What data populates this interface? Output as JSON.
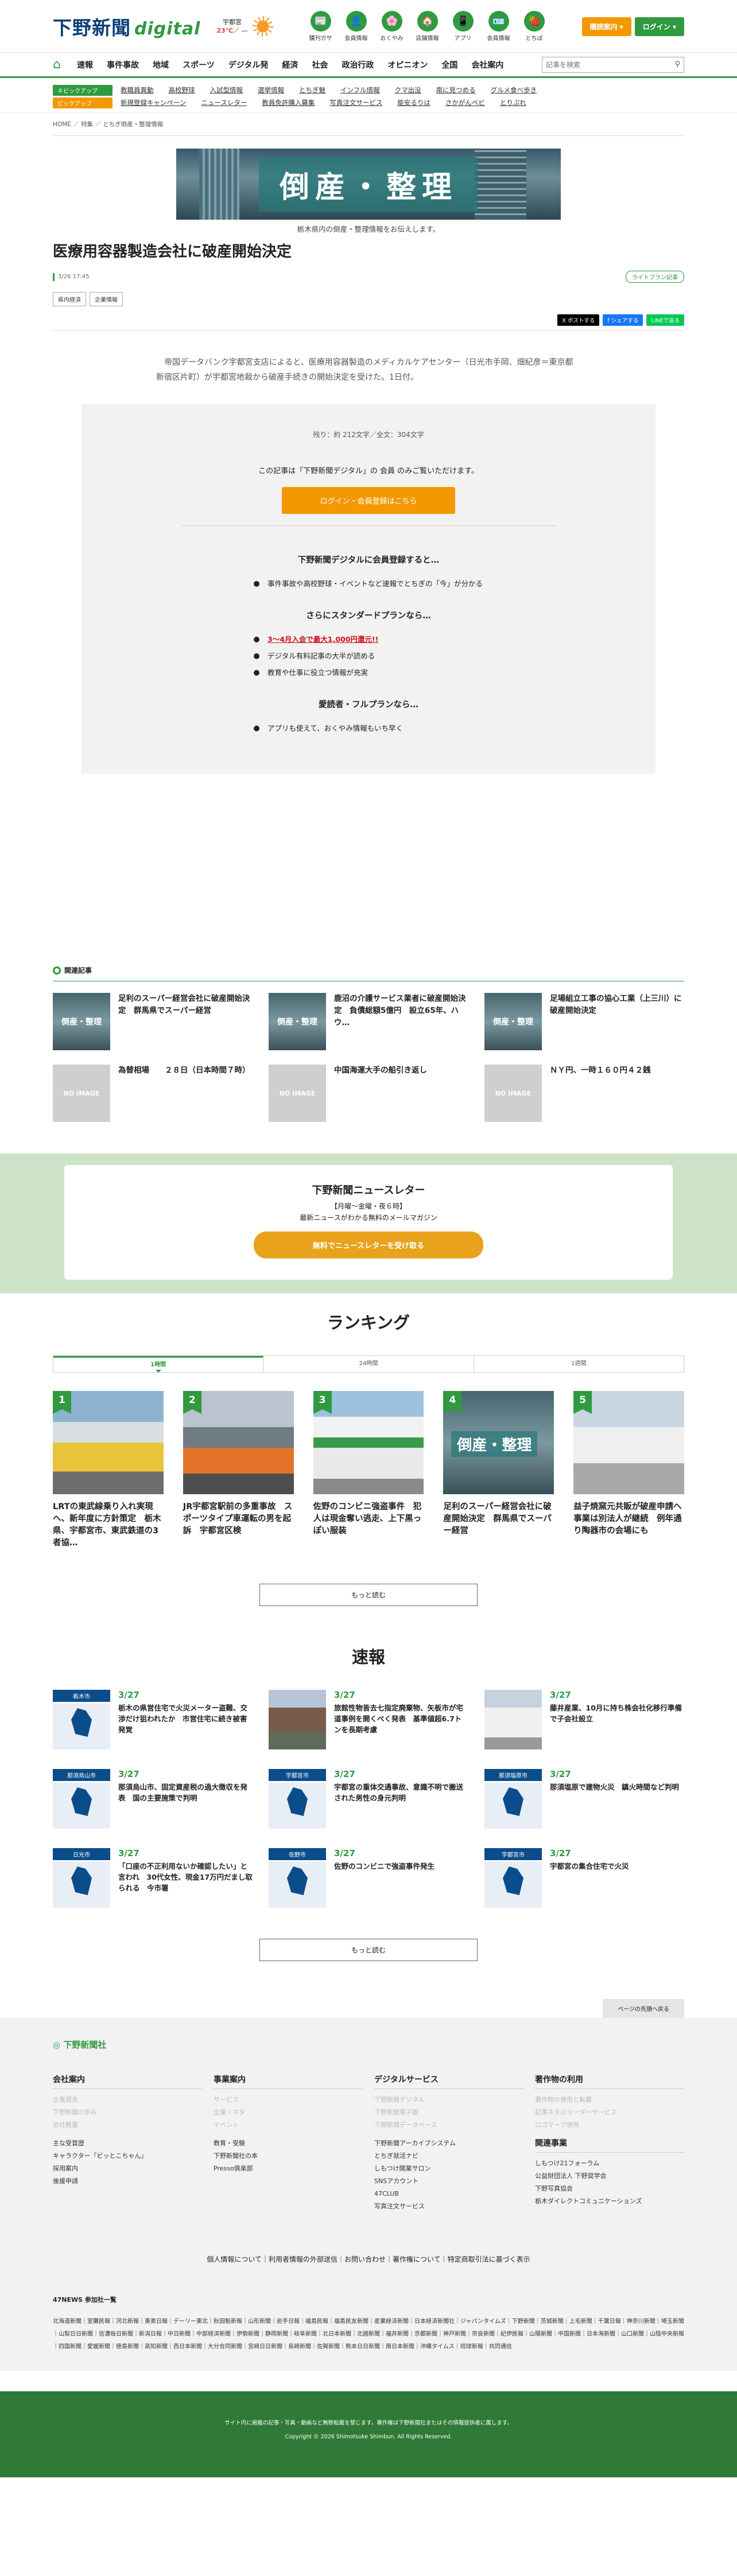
{
  "header": {
    "logo": "下野新聞",
    "logo_digital": "digital",
    "logo_digital_sub": "デジタル",
    "weather_city": "宇都宮",
    "weather_hi": "23℃",
    "weather_lo": "／ —",
    "icons": [
      {
        "label": "購刊ガサ",
        "glyph": "📰"
      },
      {
        "label": "会員情報",
        "glyph": "👤"
      },
      {
        "label": "おくやみ",
        "glyph": "🌸"
      },
      {
        "label": "店舗情報",
        "glyph": "🏠"
      },
      {
        "label": "アプリ",
        "glyph": "📱"
      },
      {
        "label": "会員情報",
        "glyph": "🪪"
      },
      {
        "label": "とちぽ",
        "glyph": "🍓"
      }
    ],
    "subscribe": "購読案内 ▾",
    "login": "ログイン ▾"
  },
  "nav": {
    "items": [
      "速報",
      "事件事故",
      "地域",
      "スポーツ",
      "デジタル発",
      "経済",
      "社会",
      "政治行政",
      "オピニオン",
      "全国",
      "会社案内"
    ],
    "search_placeholder": "記事を検索"
  },
  "subnav": {
    "row1_tag": "＃ピックアップ",
    "row1": [
      "教職員異動",
      "高校野球",
      "入試型情報",
      "選挙情報",
      "とちぎ魅",
      "インフル情報",
      "クマ出没",
      "南に見つめる",
      "グルメ食べ歩き"
    ],
    "row2_tag": "ピックアップ",
    "row2": [
      "新規登録キャンペーン",
      "ニュースレター",
      "教員免許購入募集",
      "写真注文サービス",
      "能安るりは",
      "さかがんベビ",
      "とりぷれ"
    ]
  },
  "breadcrumb": "HOME ／ 特集 ／ とちぎ倒産・整理情報",
  "article": {
    "banner_text": "倒産・整理",
    "banner_sub": "栃木県内の倒産・整理情報をお伝えします。",
    "title": "医療用容器製造会社に破産開始決定",
    "date": "3/26 17:45",
    "plan_badge": "ライトプラン記事",
    "tags": [
      "県内経済",
      "企業情報"
    ],
    "share": [
      "X ポストする",
      "f シェアする",
      "LINEで送る"
    ],
    "lead": "　帝国データバンク宇都宮支店によると、医療用容器製造のメディカルケアセンター（日光市手岡、畑紀彦＝東京都新宿区片町）が宇都宮地裁から破産手続きの開始決定を受けた。1日付。"
  },
  "paywall": {
    "remaining": "残り：約 212文字／全文：304文字",
    "only": "この記事は「下野新聞デジタル」の 会員 のみご覧いただけます。",
    "login_button": "ログイン・会員登録はこちら",
    "h_member": "下野新聞デジタルに会員登録すると…",
    "member_items": [
      "事件事故や高校野球・イベントなど速報でとちぎの「今」が分かる"
    ],
    "h_standard": "さらにスタンダードプランなら…",
    "standard_items": [
      "3～4月入会で最大1,000円還元!!",
      "デジタル有料記事の大半が読める",
      "教育や仕事に役立つ情報が充実"
    ],
    "h_full": "愛読者・フルプランなら…",
    "full_items": [
      "アプリも使えて、おくやみ情報もいち早く"
    ]
  },
  "related": {
    "heading": "関連記事",
    "items": [
      {
        "title": "足利のスーパー経営会社に破産開始決定　群馬県でスーパー経営",
        "thumb": "倒産・整理"
      },
      {
        "title": "鹿沼の介護サービス業者に破産開始決定　負債総額5億円　設立65年、ハウ…",
        "thumb": "倒産・整理"
      },
      {
        "title": "足場組立工事の協心工業（上三川）に破産開始決定",
        "thumb": "倒産・整理"
      },
      {
        "title": "為替相場　　２８日（日本時間７時）",
        "thumb": "NO IMAGE"
      },
      {
        "title": "中国海運大手の船引き返し",
        "thumb": "NO IMAGE"
      },
      {
        "title": "ＮＹ円、一時１６０円４２銭",
        "thumb": "NO IMAGE"
      }
    ]
  },
  "newsletter": {
    "title": "下野新聞ニュースレター",
    "sub1": "【月曜～金曜・夜６時】",
    "sub2": "最新ニュースがわかる無料のメールマガジン",
    "button": "無料でニュースレターを受け取る"
  },
  "ranking": {
    "heading": "ランキング",
    "tabs": [
      "1時間",
      "24時間",
      "1週間"
    ],
    "items": [
      {
        "num": "1",
        "title": "LRTの東武線乗り入れ実現へ、新年度に方針策定　栃木県、宇都宮市、東武鉄道の3者協…"
      },
      {
        "num": "2",
        "title": "JR宇都宮駅前の多重事故　スポーツタイプ車運転の男を起訴　宇都宮区検"
      },
      {
        "num": "3",
        "title": "佐野のコンビニ強盗事件　犯人は現金奪い逃走、上下黒っぽい服装"
      },
      {
        "num": "4",
        "title": "足利のスーパー経営会社に破産開始決定　群馬県でスーパー経営"
      },
      {
        "num": "5",
        "title": "益子焼窯元共販が破産申請へ　事業は別法人が継続　例年通り陶器市の会場にも"
      }
    ],
    "more": "もっと読む"
  },
  "sokuho": {
    "heading": "速報",
    "items": [
      {
        "area": "栃木市",
        "date": "3/27",
        "title": "栃木の県営住宅で火災メーター盗難、交渉だけ狙われたか　市営住宅に続き被害発覚"
      },
      {
        "area": "",
        "date": "3/27",
        "title": "旅館性物皆去七指定廃棄物、矢板市が宅道事例を開くべく発表　基準値超6.7トンを長期考慮"
      },
      {
        "area": "",
        "date": "3/27",
        "title": "藤井産業、10月に持ち株会社化移行準備で子会社設立"
      },
      {
        "area": "那須烏山市",
        "date": "3/27",
        "title": "那須烏山市、固定資産税の過大徴収を発表　国の主要施策で判明"
      },
      {
        "area": "宇都宮市",
        "date": "3/27",
        "title": "宇都宮の重体交通事故、意識不明で搬送された男性の身元判明"
      },
      {
        "area": "那須塩原市",
        "date": "3/27",
        "title": "那須塩原で建物火災　鎮火時間など判明"
      },
      {
        "area": "日光市",
        "date": "3/27",
        "title": "「口座の不正利用ないか確認したい」と言われ　30代女性、現金17万円だまし取られる　今市署"
      },
      {
        "area": "佐野市",
        "date": "3/27",
        "title": "佐野のコンビニで強盗事件発生"
      },
      {
        "area": "宇都宮市",
        "date": "3/27",
        "title": "宇都宮の集合住宅で火災"
      }
    ],
    "more": "もっと読む"
  },
  "footer": {
    "pagetop": "ページの先頭へ戻る",
    "logo": "下野新聞社",
    "cols": [
      {
        "title": "会社案内",
        "items": [
          "企業理念",
          "下野新聞の歩み",
          "会社概要"
        ]
      },
      {
        "title": "事業案内",
        "items": [
          "サービス",
          "企業・ネタ",
          "イベント"
        ]
      },
      {
        "title": "デジタルサービス",
        "items": [
          "下野新聞デジタル",
          "下野新聞電子版",
          "下野新聞データベース"
        ]
      },
      {
        "title": "著作物の利用",
        "items": [
          "著作物の使用と転載",
          "記事ネタのリーダーサービス",
          "ロゴマーク使用"
        ]
      }
    ],
    "cols2": [
      {
        "title": "",
        "items": [
          "主な受賞歴",
          "キャラクター「ピッとこちゃん」",
          "採用案内",
          "後援申請"
        ]
      },
      {
        "title": "",
        "items": [
          "教育・受験",
          "下野新聞社の本",
          "Presso俱楽部"
        ]
      },
      {
        "title": "",
        "items": [
          "下野新聞アーカイブシステム",
          "とちぎ就活ナビ",
          "しもつけ開業サロン",
          "SNSアカウント",
          "47CLUB",
          "写真注文サービス"
        ]
      },
      {
        "title": "関連事業",
        "items": [
          "しもつけ21フォーラム",
          "公益財団法人 下野奨学会",
          "下野写真協会",
          "栃木ダイレクトコミュニケーションズ"
        ]
      }
    ],
    "links": "個人情報について｜利用者情報の外部送信｜お問い合わせ｜著作権について｜特定商取引法に基づく表示",
    "n47_title": "47NEWS 参加社一覧",
    "n47": "北海道新聞｜室蘭民報｜河北新報｜東奥日報｜デーリー東北｜秋田魁新報｜山形新聞｜岩手日報｜福島民報｜福島民友新聞｜産業経済新聞｜日本経済新聞社｜ジャパンタイムズ｜下野新聞｜茨城新聞｜上毛新聞｜千葉日報｜神奈川新聞｜埼玉新聞｜山梨日日新聞｜信濃毎日新聞｜新潟日報｜中日新聞｜中部経済新聞｜伊勢新聞｜静岡新聞｜岐阜新聞｜北日本新聞｜北國新聞｜福井新聞｜京都新聞｜神戸新聞｜奈良新聞｜紀伊民報｜山陽新聞｜中国新聞｜日本海新聞｜山口新聞｜山陰中央新報｜四国新聞｜愛媛新聞｜徳島新聞｜高知新聞｜西日本新聞｜大分合同新聞｜宮崎日日新聞｜長崎新聞｜佐賀新聞｜熊本日日新聞｜南日本新聞｜沖縄タイムス｜琉球新報｜共同通信",
    "copy1": "サイト内に掲載の記事・写真・動画など無断転載を禁じます。著作権は下野新聞社またはその情報提供者に属します。",
    "copy2": "Copyright © 2026 Shimotsuke Shimbun. All Rights Reserved."
  },
  "colors": {
    "brand": "#2f9a3f",
    "accent": "#f39800",
    "logo": "#0a3f76"
  }
}
